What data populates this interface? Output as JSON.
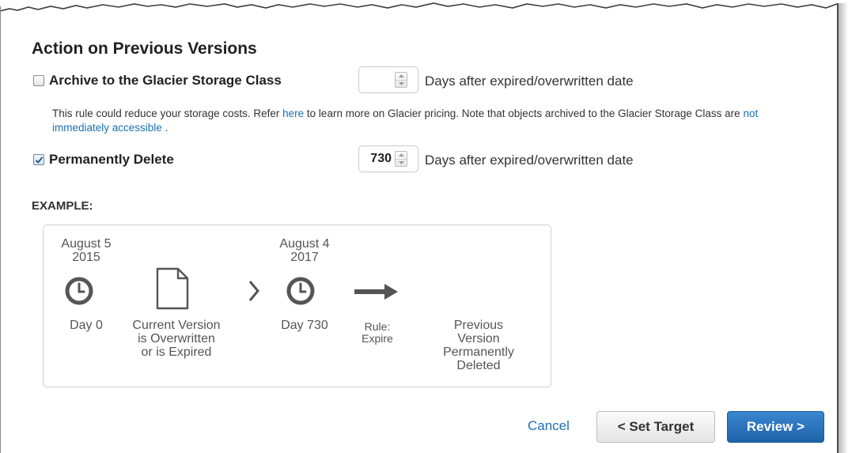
{
  "section": {
    "title": "Action on Previous Versions"
  },
  "archive": {
    "label": "Archive to the Glacier Storage Class",
    "checked": false,
    "days_value": "",
    "days_text": "Days after expired/overwritten date"
  },
  "note": {
    "text_1": "This rule could reduce your storage costs. Refer ",
    "link_here": "here",
    "text_2": " to learn more on Glacier pricing. Note that objects archived to the Glacier Storage Class are ",
    "link_access": "not immediately accessible",
    "text_3": " ."
  },
  "permanent_delete": {
    "label": "Permanently Delete",
    "checked": true,
    "days_value": "730",
    "days_text": "Days after expired/overwritten date"
  },
  "example": {
    "label": "EXAMPLE:",
    "start_date_line1": "August 5",
    "start_date_line2": "2015",
    "start_day": "Day 0",
    "current_line1": "Current Version",
    "current_line2": "is Overwritten",
    "current_line3": "or is Expired",
    "end_date_line1": "August 4",
    "end_date_line2": "2017",
    "end_day": "Day 730",
    "rule_line1": "Rule:",
    "rule_line2": "Expire",
    "result_line1": "Previous",
    "result_line2": "Version",
    "result_line3": "Permanently",
    "result_line4": "Deleted"
  },
  "footer": {
    "cancel": "Cancel",
    "back": "< Set Target",
    "next": "Review >"
  },
  "icons": {
    "checkbox_check": "check-icon",
    "spinner": "spinner-arrows-icon",
    "clock": "clock-icon",
    "document": "document-icon",
    "chevron": "chevron-right-icon",
    "arrow": "arrow-right-icon"
  },
  "colors": {
    "link": "#1a6fb5",
    "primary_button": "#2a74bf",
    "icon_dark": "#555555"
  }
}
